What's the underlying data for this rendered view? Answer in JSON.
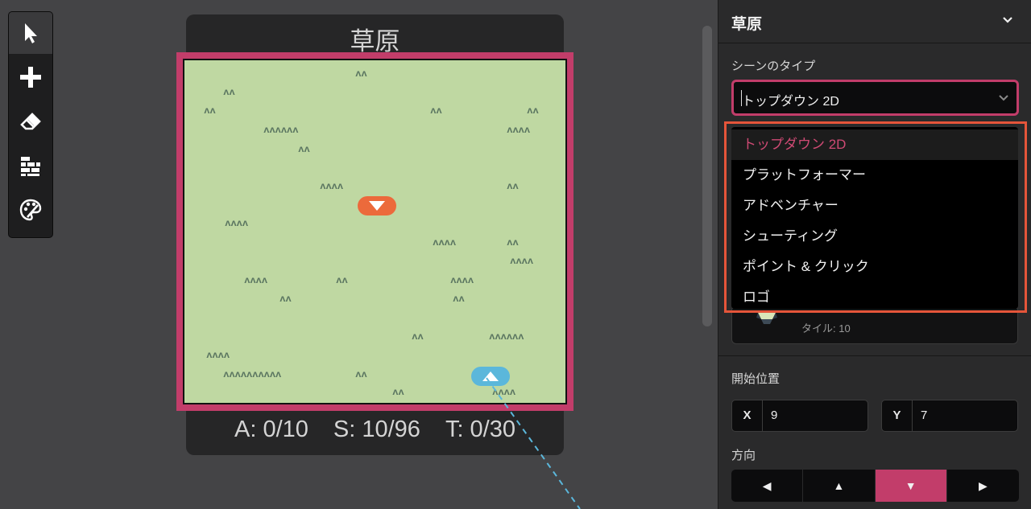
{
  "toolbar": {
    "tools": [
      {
        "icon": "cursor-icon",
        "active": true
      },
      {
        "icon": "plus-icon",
        "active": false
      },
      {
        "icon": "eraser-icon",
        "active": false
      },
      {
        "icon": "bricks-icon",
        "active": false
      },
      {
        "icon": "palette-icon",
        "active": false
      }
    ]
  },
  "scene": {
    "name": "草原",
    "stats": {
      "actors": "A: 0/10",
      "sprites": "S: 10/96",
      "triggers": "T: 0/30"
    },
    "grass_glyph": "ᴧᴧ"
  },
  "sidebar": {
    "title": "草原",
    "scene_type_label": "シーンのタイプ",
    "scene_type_value": "トップダウン 2D",
    "scene_type_options": [
      "トップダウン 2D",
      "プラットフォーマー",
      "アドベンチャー",
      "シューティング",
      "ポイント & クリック",
      "ロゴ"
    ],
    "tile_count": "タイル: 10",
    "start_position_label": "開始位置",
    "start_x_label": "X",
    "start_x_value": "9",
    "start_y_label": "Y",
    "start_y_value": "7",
    "direction_label": "方向",
    "directions": [
      "◀",
      "▲",
      "▼",
      "▶"
    ],
    "active_direction": "▼"
  },
  "colors": {
    "accent": "#c23d6a",
    "dropdown_outline": "#e5553a",
    "scene_bg": "#bfd8a2",
    "actor_marker": "#ec6a3b",
    "player_marker": "#5bb7db"
  }
}
